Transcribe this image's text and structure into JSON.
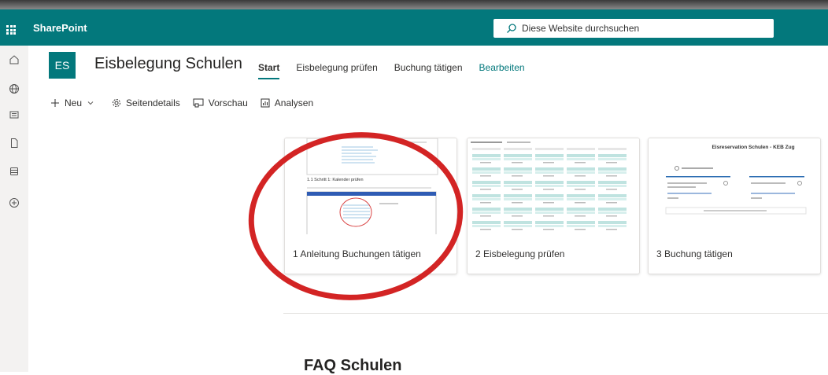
{
  "brand": "SharePoint",
  "search": {
    "placeholder": "Diese Website durchsuchen"
  },
  "site": {
    "logo_initials": "ES",
    "title": "Eisbelegung Schulen"
  },
  "nav": [
    {
      "label": "Start",
      "active": true
    },
    {
      "label": "Eisbelegung prüfen"
    },
    {
      "label": "Buchung tätigen"
    },
    {
      "label": "Bearbeiten"
    }
  ],
  "commands": {
    "new": "Neu",
    "page_details": "Seitendetails",
    "preview": "Vorschau",
    "analytics": "Analysen"
  },
  "cards": [
    {
      "title": "1 Anleitung Buchungen tätigen",
      "thumb_heading": "1.1 Schritt 1: Kalender prüfen"
    },
    {
      "title": "2 Eisbelegung prüfen"
    },
    {
      "title": "3 Buchung tätigen",
      "thumb_heading": "Eisreservation Schulen - KEB Zug"
    }
  ],
  "section_heading": "FAQ Schulen",
  "colors": {
    "accent": "#03787c",
    "annotation": "#d32424"
  }
}
